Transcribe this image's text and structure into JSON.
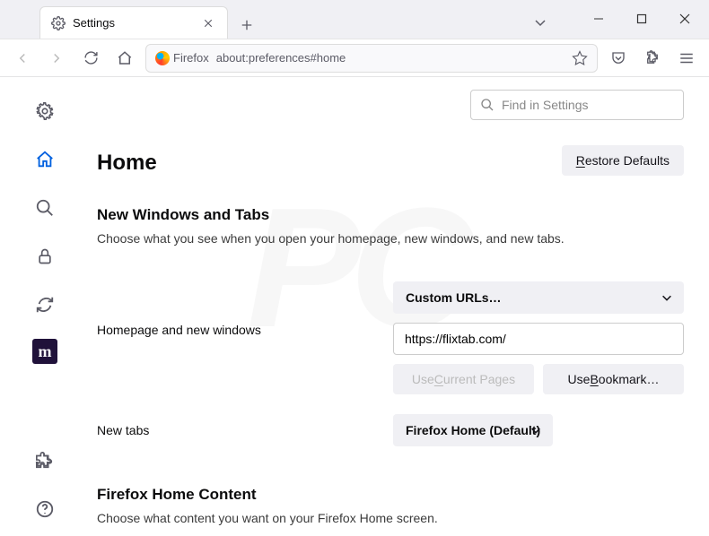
{
  "tab": {
    "title": "Settings"
  },
  "urlbar": {
    "brand": "Firefox",
    "url": "about:preferences#home"
  },
  "find": {
    "placeholder": "Find in Settings"
  },
  "page": {
    "title": "Home",
    "restore_label": "estore Defaults",
    "restore_prefix": "R"
  },
  "sections": {
    "nwt": {
      "heading": "New Windows and Tabs",
      "desc": "Choose what you see when you open your homepage, new windows, and new tabs."
    },
    "fhc": {
      "heading": "Firefox Home Content",
      "desc": "Choose what content you want on your Firefox Home screen."
    }
  },
  "rows": {
    "homepage": {
      "label": "Homepage and new windows",
      "select": "Custom URLs…",
      "url_value": "https://flixtab.com/",
      "use_current_pre": "Use ",
      "use_current_u": "C",
      "use_current_post": "urrent Pages",
      "use_bookmark_pre": "Use ",
      "use_bookmark_u": "B",
      "use_bookmark_post": "ookmark…"
    },
    "newtabs": {
      "label": "New tabs",
      "select": "Firefox Home (Default)"
    }
  }
}
